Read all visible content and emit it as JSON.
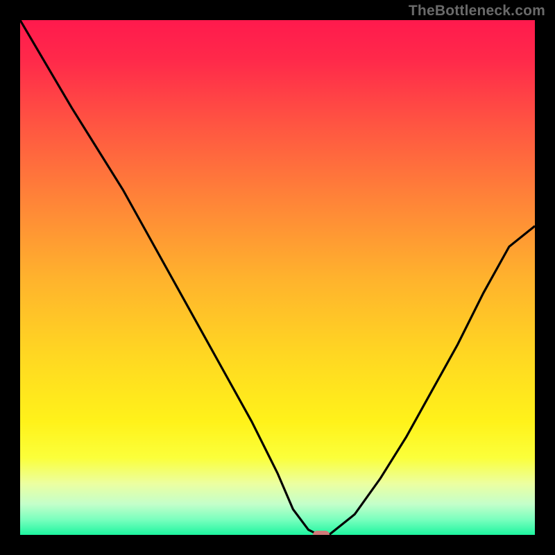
{
  "attribution": "TheBottleneck.com",
  "chart_data": {
    "type": "line",
    "title": "",
    "xlabel": "",
    "ylabel": "",
    "xlim": [
      0,
      100
    ],
    "ylim": [
      0,
      100
    ],
    "series": [
      {
        "name": "curve",
        "x": [
          0,
          5,
          10,
          15,
          20,
          25,
          30,
          35,
          40,
          45,
          50,
          53,
          56,
          58,
          60,
          65,
          70,
          75,
          80,
          85,
          90,
          95,
          100
        ],
        "y": [
          100,
          91.5,
          83,
          75,
          67,
          58,
          49,
          40,
          31,
          22,
          12,
          5,
          1,
          0,
          0,
          4,
          11,
          19,
          28,
          37,
          47,
          56,
          60
        ]
      }
    ],
    "marker": {
      "x": 58.5,
      "y": 0
    },
    "background_gradient": {
      "stops": [
        {
          "pos": 0.0,
          "color": "#ff1a4d"
        },
        {
          "pos": 0.08,
          "color": "#ff2a4a"
        },
        {
          "pos": 0.2,
          "color": "#ff5442"
        },
        {
          "pos": 0.35,
          "color": "#ff8438"
        },
        {
          "pos": 0.5,
          "color": "#ffb22d"
        },
        {
          "pos": 0.65,
          "color": "#ffd722"
        },
        {
          "pos": 0.78,
          "color": "#fff21a"
        },
        {
          "pos": 0.85,
          "color": "#fbff3a"
        },
        {
          "pos": 0.9,
          "color": "#ecffa0"
        },
        {
          "pos": 0.94,
          "color": "#c4ffca"
        },
        {
          "pos": 0.97,
          "color": "#7affbe"
        },
        {
          "pos": 1.0,
          "color": "#1ef5a0"
        }
      ]
    }
  }
}
